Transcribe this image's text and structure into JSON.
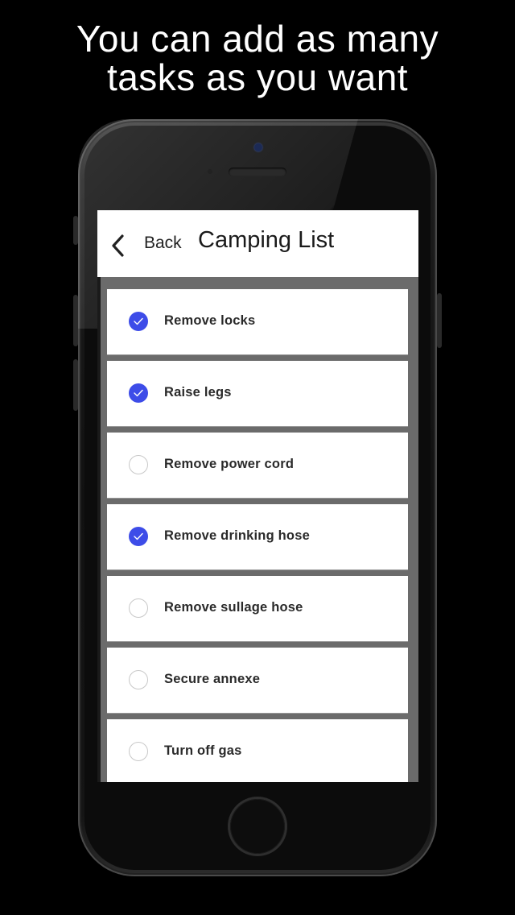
{
  "headline": {
    "line1": "You can add as many",
    "line2": "tasks as you want"
  },
  "nav": {
    "back_icon": "chevron-left-icon",
    "back_label": "Back",
    "title": "Camping List"
  },
  "colors": {
    "accent": "#3d4ce8",
    "list_background": "#6b6b6b"
  },
  "tasks": [
    {
      "label": "Remove locks",
      "checked": true
    },
    {
      "label": "Raise legs",
      "checked": true
    },
    {
      "label": "Remove power cord",
      "checked": false
    },
    {
      "label": "Remove drinking hose",
      "checked": true
    },
    {
      "label": "Remove sullage hose",
      "checked": false
    },
    {
      "label": "Secure annexe",
      "checked": false
    },
    {
      "label": "Turn off gas",
      "checked": false
    }
  ]
}
